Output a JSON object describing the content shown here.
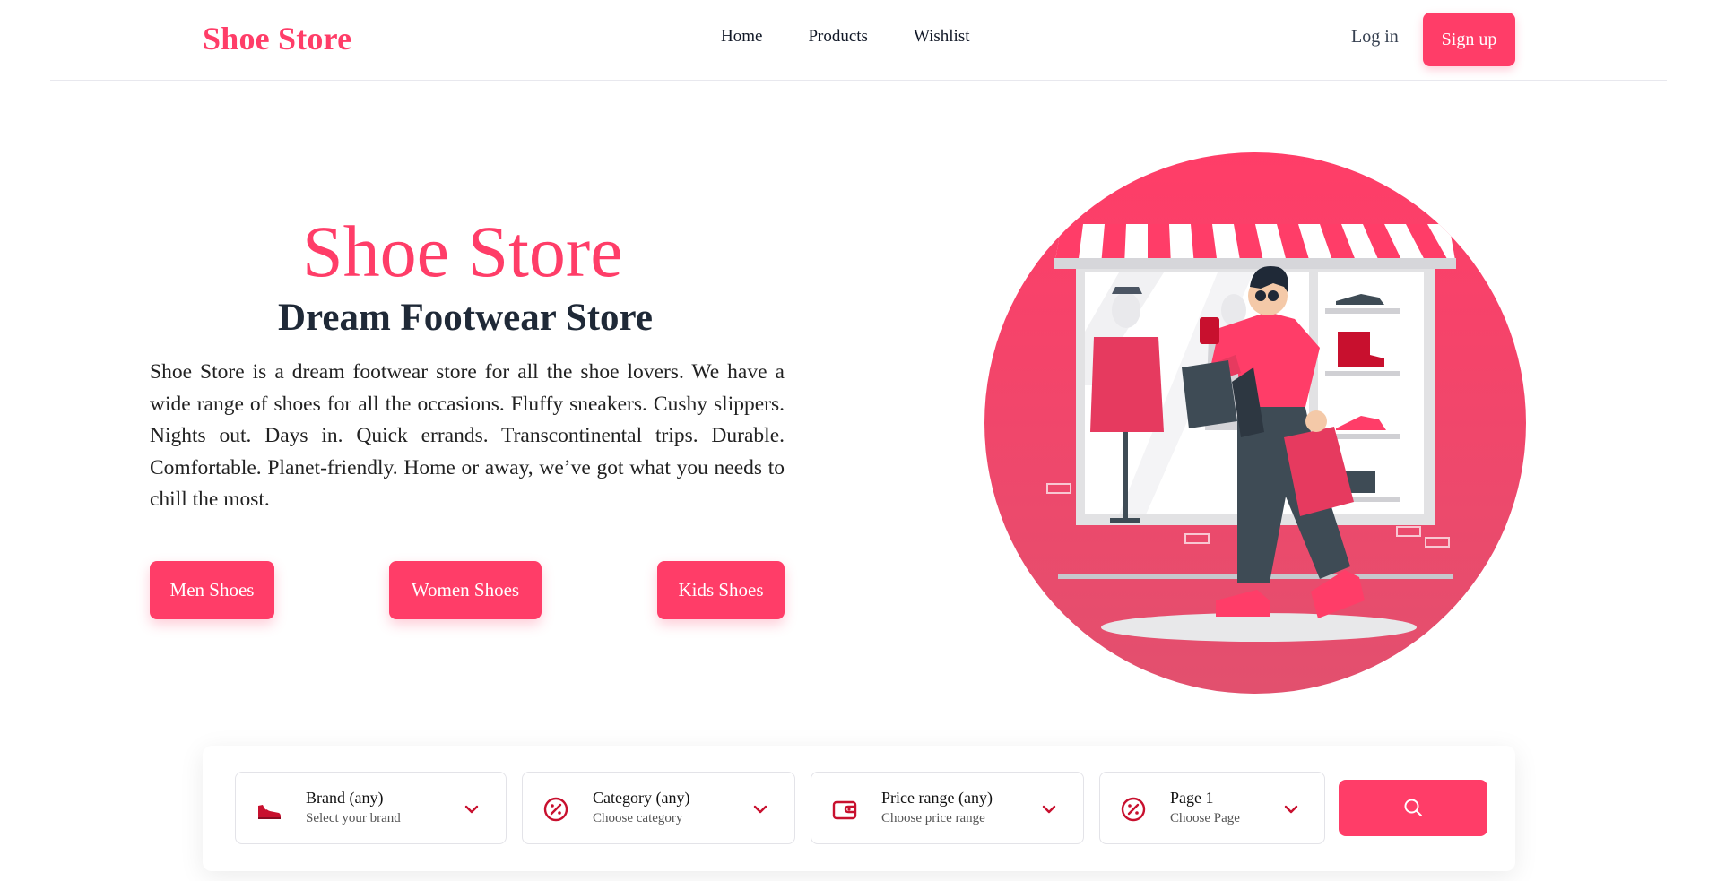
{
  "header": {
    "brand": "Shoe Store",
    "nav": [
      "Home",
      "Products",
      "Wishlist"
    ],
    "login": "Log in",
    "signup": "Sign up"
  },
  "hero": {
    "title": "Shoe Store",
    "subtitle": "Dream Footwear Store",
    "description": "Shoe Store is a dream footwear store for all the shoe lovers. We have a wide range of shoes for all the occasions. Fluffy sneakers. Cushy slippers. Nights out. Days in. Quick errands. Transcontinental trips. Durable. Comfortable. Planet-friendly. Home or away, we’ve got what you needs to chill the most.",
    "buttons": [
      "Men Shoes",
      "Women Shoes",
      "Kids Shoes"
    ]
  },
  "filters": [
    {
      "title": "Brand (any)",
      "subtitle": "Select your brand",
      "icon": "shoe-icon"
    },
    {
      "title": "Category (any)",
      "subtitle": "Choose category",
      "icon": "percent-icon"
    },
    {
      "title": "Price range (any)",
      "subtitle": "Choose price range",
      "icon": "wallet-icon"
    },
    {
      "title": "Page 1",
      "subtitle": "Choose Page",
      "icon": "percent-icon"
    }
  ],
  "search": {
    "icon": "search-icon"
  },
  "colors": {
    "accent": "#ff3d68",
    "text": "#1f2937",
    "filter_icon": "#c8102e"
  }
}
